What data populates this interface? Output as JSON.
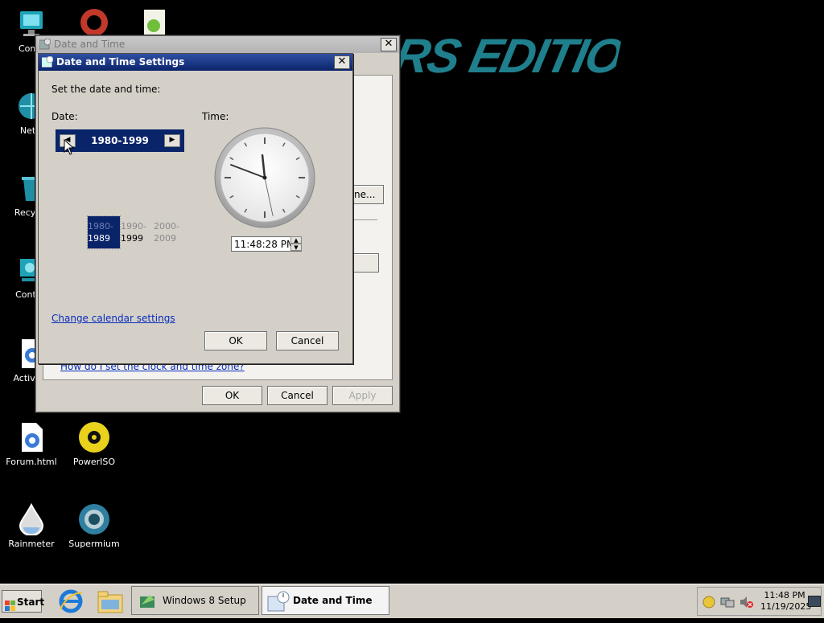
{
  "wallpaper": {
    "title_text": "GERS EDITION"
  },
  "desktop_icons": [
    {
      "label": "Comp",
      "icon": "computer-icon"
    },
    {
      "label": "Netw",
      "icon": "network-icon"
    },
    {
      "label": "Recycle",
      "icon": "recycle-bin-icon"
    },
    {
      "label": "Control",
      "icon": "control-panel-icon"
    },
    {
      "label": "Activato",
      "icon": "activator-icon"
    },
    {
      "label": "Forum.html",
      "icon": "html-file-icon"
    },
    {
      "label": "PowerISO",
      "icon": "poweriso-icon"
    },
    {
      "label": "Rainmeter",
      "icon": "rainmeter-icon"
    },
    {
      "label": "Supermium",
      "icon": "supermium-icon"
    }
  ],
  "outer_window": {
    "title": "Date and Time",
    "close_glyph": "✕",
    "partial_button_label": "ne...",
    "help_link": "How do I set the clock and time zone?",
    "buttons": {
      "ok": "OK",
      "cancel": "Cancel",
      "apply": "Apply"
    }
  },
  "inner_window": {
    "title": "Date and Time Settings",
    "close_glyph": "✕",
    "instruction": "Set the date and time:",
    "date_label": "Date:",
    "time_label": "Time:",
    "calendar": {
      "header": "1980-1999",
      "prev_glyph": "◀",
      "next_glyph": "▶",
      "decades": [
        {
          "top": "1980-",
          "bottom": "1989",
          "selected": true
        },
        {
          "top": "1990-",
          "bottom": "1999",
          "selected": false
        },
        {
          "top": "2000-",
          "bottom": "2009",
          "selected": false
        }
      ]
    },
    "clock": {
      "hour": 11,
      "minute": 48,
      "second": 28
    },
    "time_value": "11:48:28 PM",
    "spin_up": "▲",
    "spin_down": "▼",
    "change_calendar_link": "Change calendar settings",
    "buttons": {
      "ok": "OK",
      "cancel": "Cancel"
    }
  },
  "taskbar": {
    "start_label": "Start",
    "buttons": [
      {
        "label": "Windows 8 Setup",
        "active": false
      },
      {
        "label": "Date and Time",
        "active": true
      }
    ],
    "clock_time": "11:48 PM",
    "clock_date": "11/19/2025"
  },
  "colors": {
    "accent": "#0a246a",
    "link": "#0a2dbd",
    "wallpaper_text": "#1f7f8c"
  }
}
